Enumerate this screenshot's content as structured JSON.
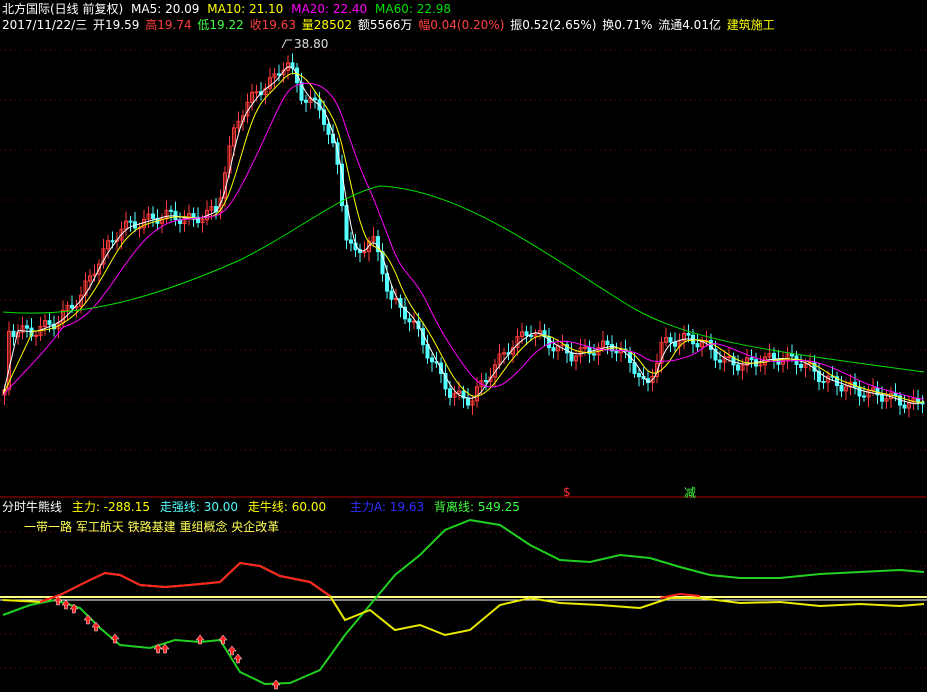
{
  "header": {
    "stock_title": "北方国际(日线 前复权)",
    "ma5": "MA5: 20.09",
    "ma10": "MA10: 21.10",
    "ma20": "MA20: 22.40",
    "ma60": "MA60: 22.98",
    "date": "2017/11/22/三",
    "open": "开19.59",
    "high": "高19.74",
    "low": "低19.22",
    "close": "收19.63",
    "volume": "量28502",
    "amount": "额5566万",
    "change": "幅0.04(0.20%)",
    "amplitude": "振0.52(2.65%)",
    "turnover": "换0.71%",
    "float_cap": "流通4.01亿",
    "sector": "建筑施工"
  },
  "price_chart": {
    "high_label": "38.80",
    "signal_s": "$",
    "signal_jian": "减"
  },
  "indicator": {
    "name": "分时牛熊线",
    "main_force": "主力: -288.15",
    "strong_line": "走强线: 30.00",
    "bull_line": "走牛线: 60.00",
    "main_force_a": "主力A: 19.63",
    "divergence": "背离线: 549.25",
    "concepts": "一带一路 军工航天 铁路基建 重组概念 央企改革"
  },
  "colors": {
    "up": "#ff3b3b",
    "down": "#54ffff",
    "ma5": "#ffffff",
    "ma10": "#ffff00",
    "ma20": "#ff00ff",
    "ma60": "#00e000",
    "grid": "#8b0000"
  }
}
